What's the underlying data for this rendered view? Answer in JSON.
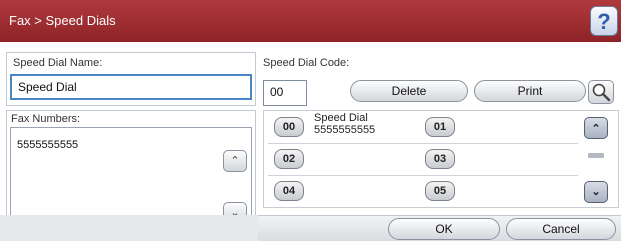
{
  "header": {
    "title": "Fax > Speed Dials",
    "help_icon": "?"
  },
  "speed_dial_name": {
    "label": "Speed Dial Name:",
    "value": "Speed Dial"
  },
  "fax_numbers": {
    "label": "Fax Numbers:",
    "value": "5555555555"
  },
  "speed_dial_code": {
    "label": "Speed Dial Code:",
    "value": "00"
  },
  "buttons": {
    "delete": "Delete",
    "print": "Print",
    "ok": "OK",
    "cancel": "Cancel"
  },
  "speed_dial_list": [
    {
      "code": "00",
      "name": "Speed Dial",
      "number": "5555555555"
    },
    {
      "code": "01",
      "name": "",
      "number": ""
    },
    {
      "code": "02",
      "name": "",
      "number": ""
    },
    {
      "code": "03",
      "name": "",
      "number": ""
    },
    {
      "code": "04",
      "name": "",
      "number": ""
    },
    {
      "code": "05",
      "name": "",
      "number": ""
    }
  ],
  "icons": {
    "help": "help-icon",
    "search": "search-icon",
    "scroll_up": "chevron-up-icon",
    "scroll_down": "chevron-down-icon",
    "list_up": "chevron-up-icon",
    "list_down": "chevron-down-icon"
  },
  "colors": {
    "header": "#9c2b2f",
    "accent": "#4a86c5"
  }
}
